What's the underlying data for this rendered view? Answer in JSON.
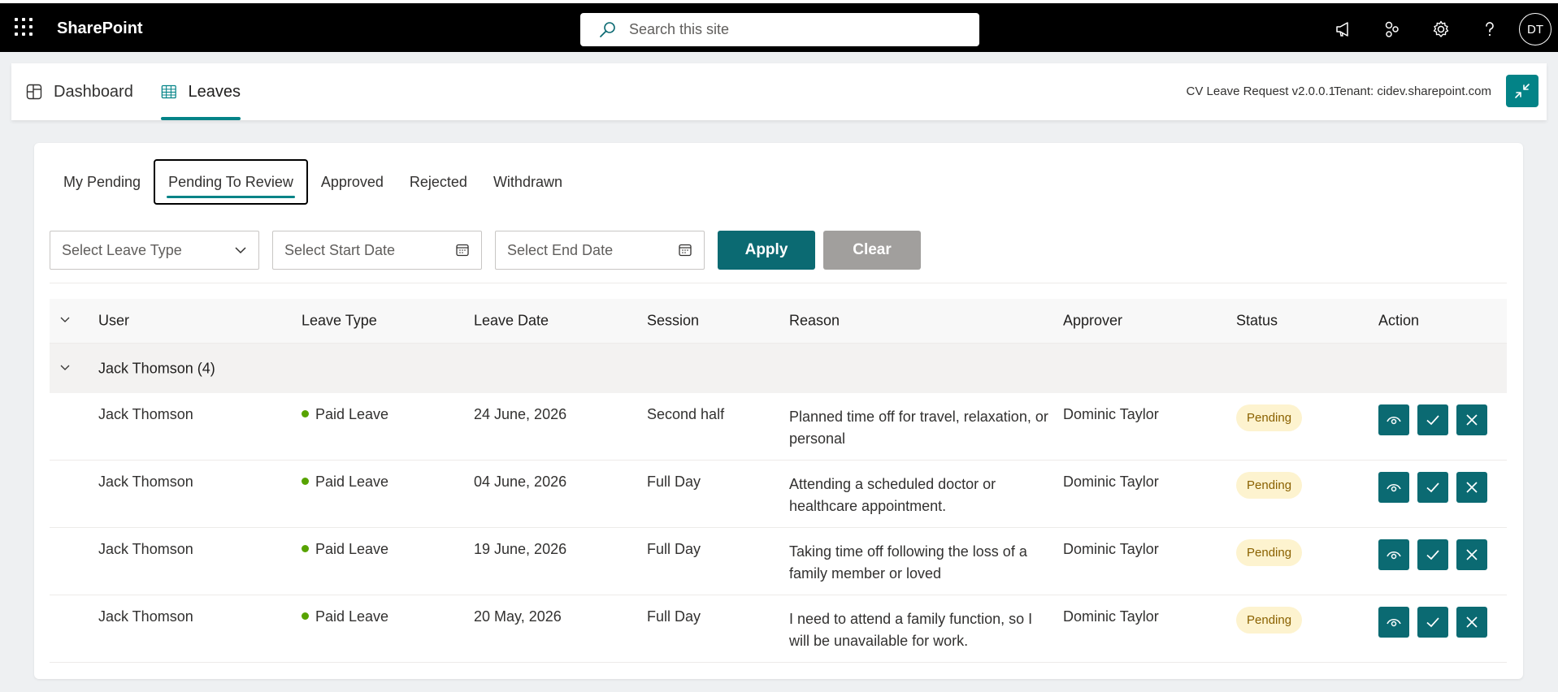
{
  "suite": {
    "brand": "SharePoint",
    "search_placeholder": "Search this site",
    "avatar_initials": "DT"
  },
  "app": {
    "tabs": [
      {
        "label": "Dashboard",
        "icon": "dashboard-icon"
      },
      {
        "label": "Leaves",
        "icon": "table-icon",
        "active": true
      }
    ],
    "version": "CV Leave Request v2.0.0.1",
    "tenant": "Tenant: cidev.sharepoint.com"
  },
  "subtabs": [
    "My Pending",
    "Pending To Review",
    "Approved",
    "Rejected",
    "Withdrawn"
  ],
  "filters": {
    "leave_type_placeholder": "Select Leave Type",
    "start_date_placeholder": "Select Start Date",
    "end_date_placeholder": "Select End Date",
    "apply_label": "Apply",
    "clear_label": "Clear"
  },
  "table": {
    "columns": [
      "User",
      "Leave Type",
      "Leave Date",
      "Session",
      "Reason",
      "Approver",
      "Status",
      "Action"
    ],
    "group_label": "Jack Thomson (4)",
    "rows": [
      {
        "user": "Jack Thomson",
        "type": "Paid Leave",
        "date": "24 June, 2026",
        "session": "Second half",
        "reason": "Planned time off for travel, relaxation, or personal",
        "approver": "Dominic Taylor",
        "status": "Pending"
      },
      {
        "user": "Jack Thomson",
        "type": "Paid Leave",
        "date": "04 June, 2026",
        "session": "Full Day",
        "reason": "Attending a scheduled doctor or healthcare appointment.",
        "approver": "Dominic Taylor",
        "status": "Pending"
      },
      {
        "user": "Jack Thomson",
        "type": "Paid Leave",
        "date": "19 June, 2026",
        "session": "Full Day",
        "reason": "Taking time off following the loss of a family member or loved",
        "approver": "Dominic Taylor",
        "status": "Pending"
      },
      {
        "user": "Jack Thomson",
        "type": "Paid Leave",
        "date": "20 May, 2026",
        "session": "Full Day",
        "reason": "I need to attend a family function, so I will be unavailable for work.",
        "approver": "Dominic Taylor",
        "status": "Pending"
      }
    ]
  },
  "colors": {
    "accent": "#038387",
    "button_teal": "#0b6a72",
    "status_pending_bg": "#fdf3cf",
    "leave_dot": "#57a300"
  }
}
